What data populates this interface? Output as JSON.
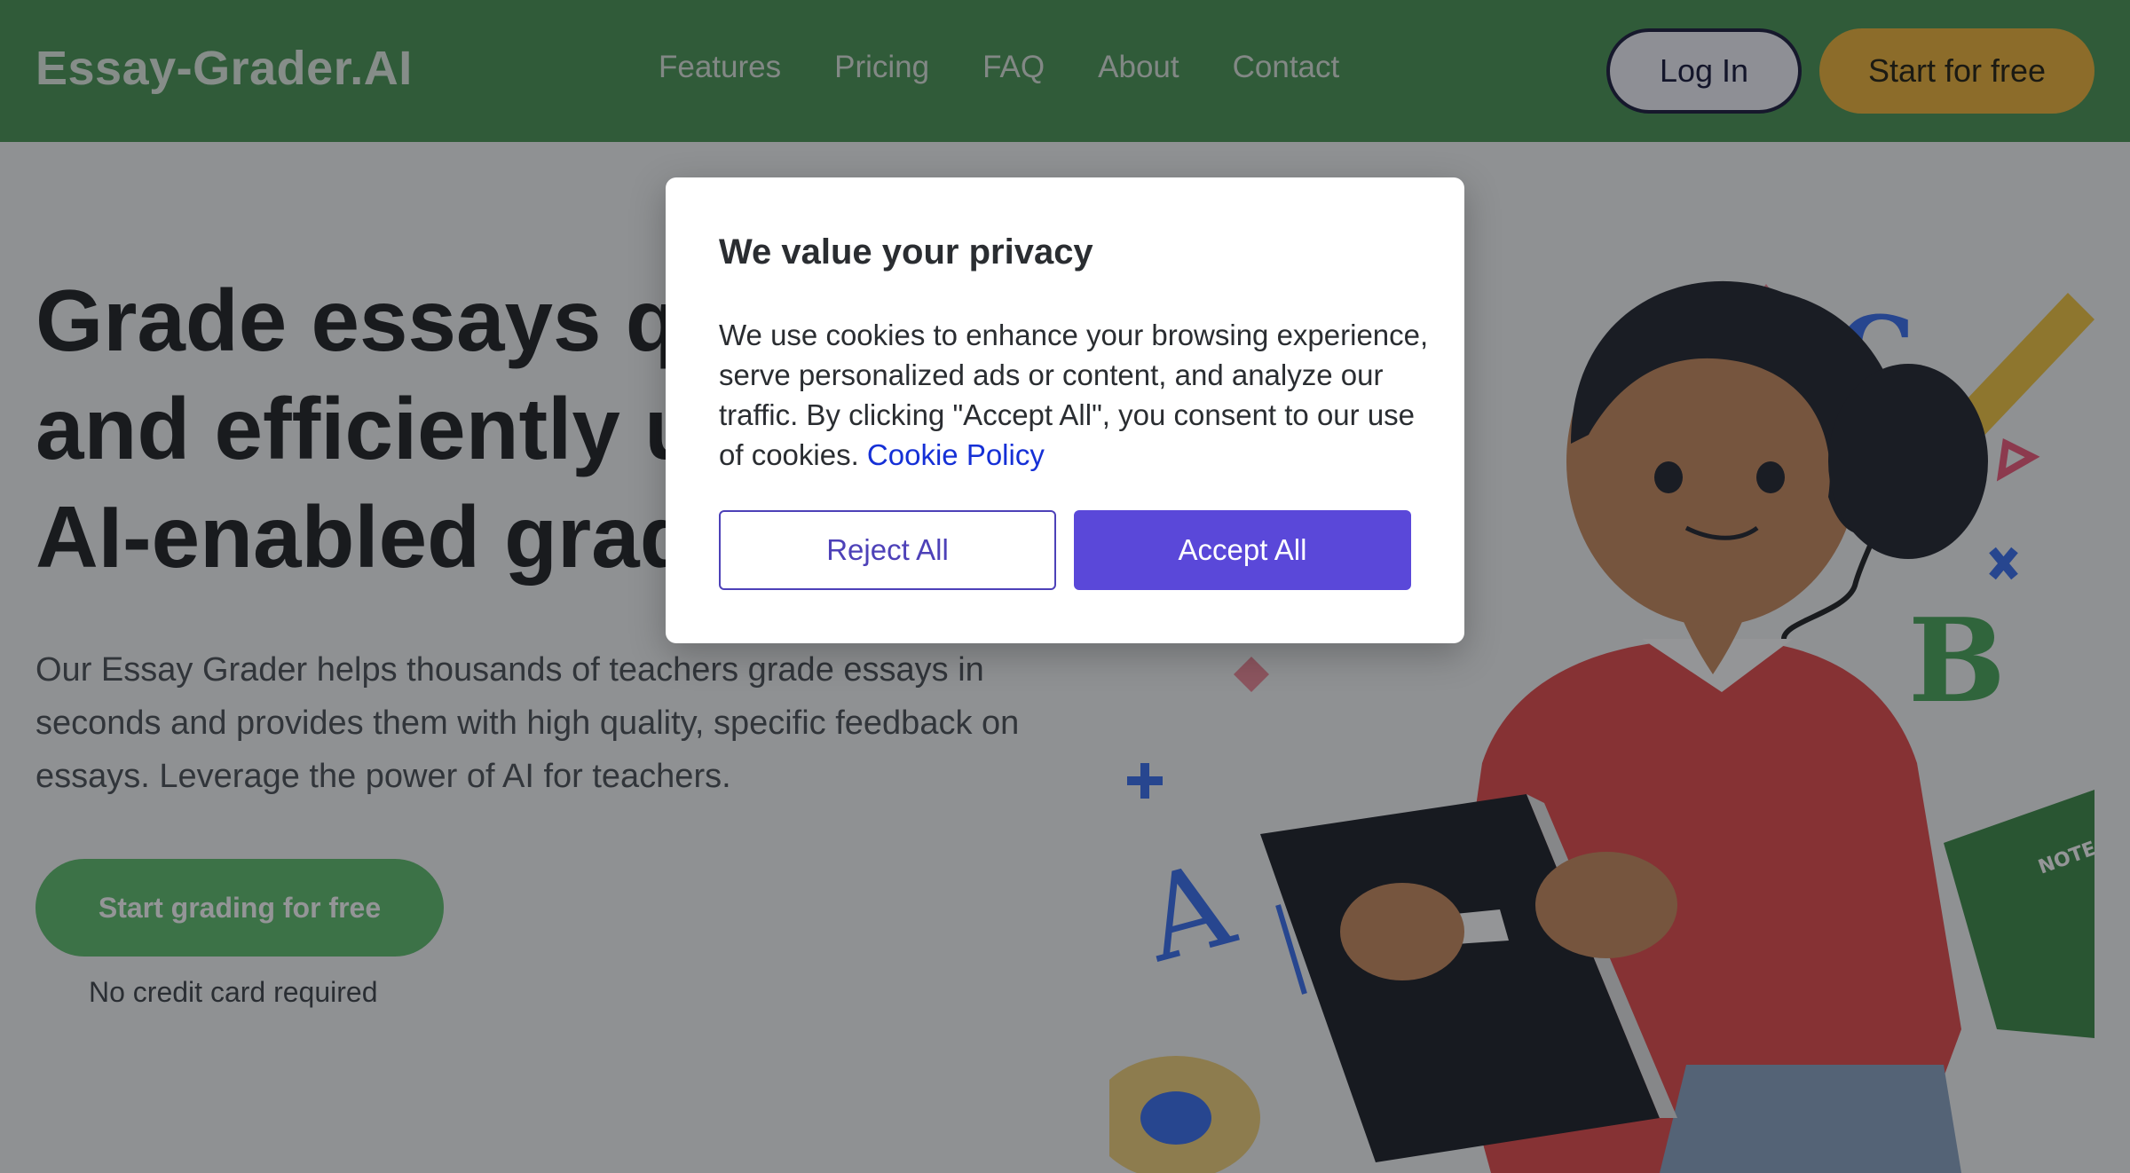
{
  "header": {
    "logo": "Essay-Grader.AI",
    "nav": [
      "Features",
      "Pricing",
      "FAQ",
      "About",
      "Contact"
    ],
    "login_label": "Log In",
    "start_label": "Start for free"
  },
  "hero": {
    "title": "Grade essays quickly and efficiently using our AI-enabled grading tools",
    "description": "Our Essay Grader helps thousands of teachers grade essays in seconds and provides them with high quality, specific feedback on essays. Leverage the power of AI for teachers.",
    "cta_label": "Start grading for free",
    "cta_note": "No credit card required",
    "illustration_letters": [
      "C",
      "B",
      "A"
    ],
    "notebook_label": "NOTE"
  },
  "cookie_modal": {
    "title": "We value your privacy",
    "body": "We use cookies to enhance your browsing experience, serve personalized ads or content, and analyze our traffic. By clicking \"Accept All\", you consent to our use of cookies.",
    "policy_link": "Cookie Policy",
    "reject_label": "Reject All",
    "accept_label": "Accept All"
  },
  "colors": {
    "header_bg": "#499654",
    "start_button": "#f0b43a",
    "cta_button": "#5fbf6e",
    "accept_button": "#5a48d9",
    "link": "#1530d6"
  }
}
